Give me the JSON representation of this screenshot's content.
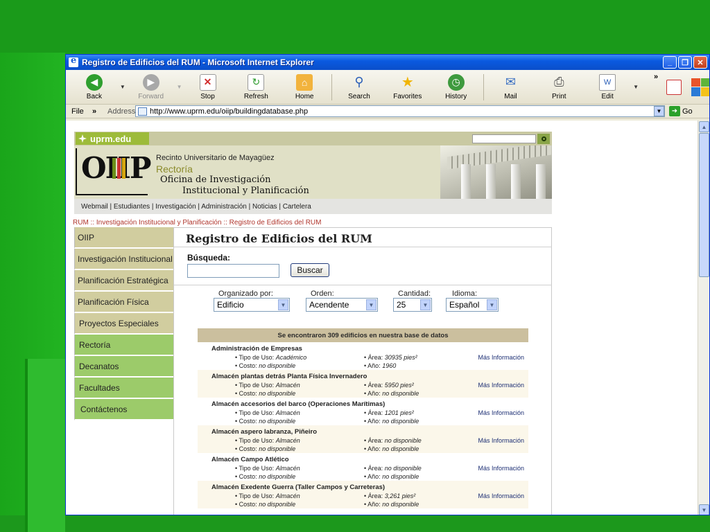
{
  "window": {
    "title": "Registro de Edificios del RUM - Microsoft Internet Explorer",
    "controls": [
      "_",
      "❐",
      "✕"
    ]
  },
  "toolbar": {
    "buttons": [
      {
        "label": "Back",
        "icon": "back-arrow-icon"
      },
      {
        "label": "Forward",
        "icon": "forward-arrow-icon"
      },
      {
        "label": "Stop",
        "icon": "stop-icon"
      },
      {
        "label": "Refresh",
        "icon": "refresh-icon"
      },
      {
        "label": "Home",
        "icon": "home-icon"
      },
      {
        "label": "Search",
        "icon": "search-icon"
      },
      {
        "label": "Favorites",
        "icon": "star-icon"
      },
      {
        "label": "History",
        "icon": "history-icon"
      },
      {
        "label": "Mail",
        "icon": "mail-icon"
      },
      {
        "label": "Print",
        "icon": "printer-icon"
      },
      {
        "label": "Edit",
        "icon": "edit-icon"
      }
    ],
    "chevron": "»"
  },
  "addressbar": {
    "file": "File",
    "chevron": "»",
    "label": "Address",
    "url": "http://www.uprm.edu/oiip/buildingdatabase.php",
    "go": "Go"
  },
  "site": {
    "logo": "uprm.edu",
    "banner": {
      "logo_text": "OIIP",
      "recinto": "Recinto Universitario de Mayagüez",
      "rectoria": "Rectoría",
      "oficina_line1": "Oficina de Investigación",
      "oficina_line2": "Institucional y Planificación"
    },
    "topnav": "Webmail | Estudiantes | Investigación | Administración | Noticias | Cartelera",
    "breadcrumb": "RUM :: Investigación Institucional y Planificación :: Registro de Edificios del RUM",
    "leftnav": [
      {
        "label": "OIIP"
      },
      {
        "label": "Investigación Institucional"
      },
      {
        "label": "Planificación Estratégica"
      },
      {
        "label": "Planificación Física"
      },
      {
        "label": "Proyectos Especiales"
      },
      {
        "label": "Rectoría"
      },
      {
        "label": "Decanatos"
      },
      {
        "label": "Facultades"
      },
      {
        "label": "Contáctenos"
      }
    ]
  },
  "panel": {
    "title": "Registro de Edificios del RUM",
    "search_label": "Búsqueda:",
    "search_value": "",
    "search_button": "Buscar",
    "filters": {
      "organizado_label": "Organizado por:",
      "organizado_value": "Edificio",
      "orden_label": "Orden:",
      "orden_value": "Acendente",
      "cantidad_label": "Cantidad:",
      "cantidad_value": "25",
      "idioma_label": "Idioma:",
      "idioma_value": "Español"
    },
    "results_header": "Se encontraron 309 edificios en nuestra base de datos",
    "more_label": "Más Información",
    "results": [
      {
        "name": "Administración de Empresas",
        "tipo_label": "• Tipo de Uso:",
        "tipo": "Académico",
        "costo_label": "• Costo:",
        "costo": "no disponible",
        "area_label": "• Área:",
        "area": "30935 pies²",
        "ano_label": "• Año:",
        "ano": "1960"
      },
      {
        "name": "Almacén plantas detrás Planta Física Invernadero",
        "tipo_label": "• Tipo de Uso:",
        "tipo": "Almacén",
        "costo_label": "• Costo:",
        "costo": "no disponible",
        "area_label": "• Área:",
        "area": "5950 pies²",
        "ano_label": "• Año:",
        "ano": "no disponible"
      },
      {
        "name": "Almacén accesorios del barco (Operaciones Marítimas)",
        "tipo_label": "• Tipo de Uso:",
        "tipo": "Almacén",
        "costo_label": "• Costo:",
        "costo": "no disponible",
        "area_label": "• Área:",
        "area": "1201 pies²",
        "ano_label": "• Año:",
        "ano": "no disponible"
      },
      {
        "name": "Almacén aspero labranza, Piñeiro",
        "tipo_label": "• Tipo de Uso:",
        "tipo": "Almacén",
        "costo_label": "• Costo:",
        "costo": "no disponible",
        "area_label": "• Área:",
        "area": "no disponible",
        "ano_label": "• Año:",
        "ano": "no disponible"
      },
      {
        "name": "Almacén Campo Atlético",
        "tipo_label": "• Tipo de Uso:",
        "tipo": "Almacén",
        "costo_label": "• Costo:",
        "costo": "no disponible",
        "area_label": "• Área:",
        "area": "no disponible",
        "ano_label": "• Año:",
        "ano": "no disponible"
      },
      {
        "name": "Almacén Exedente Guerra (Taller Campos y Carreteras)",
        "tipo_label": "• Tipo de Uso:",
        "tipo": "Almacén",
        "costo_label": "• Costo:",
        "costo": "no disponible",
        "area_label": "• Área:",
        "area": "3,261 pies²",
        "ano_label": "• Año:",
        "ano": "no disponible"
      }
    ]
  },
  "colors": {
    "desktop_green": "#1f9d1f",
    "titlebar_blue": "#0a5ae0",
    "nav_tan": "#d1cd9f",
    "nav_green": "#9ccb6a",
    "results_header": "#cbbf9e",
    "link_blue": "#1d2f74",
    "breadcrumb_red": "#b0362d"
  }
}
